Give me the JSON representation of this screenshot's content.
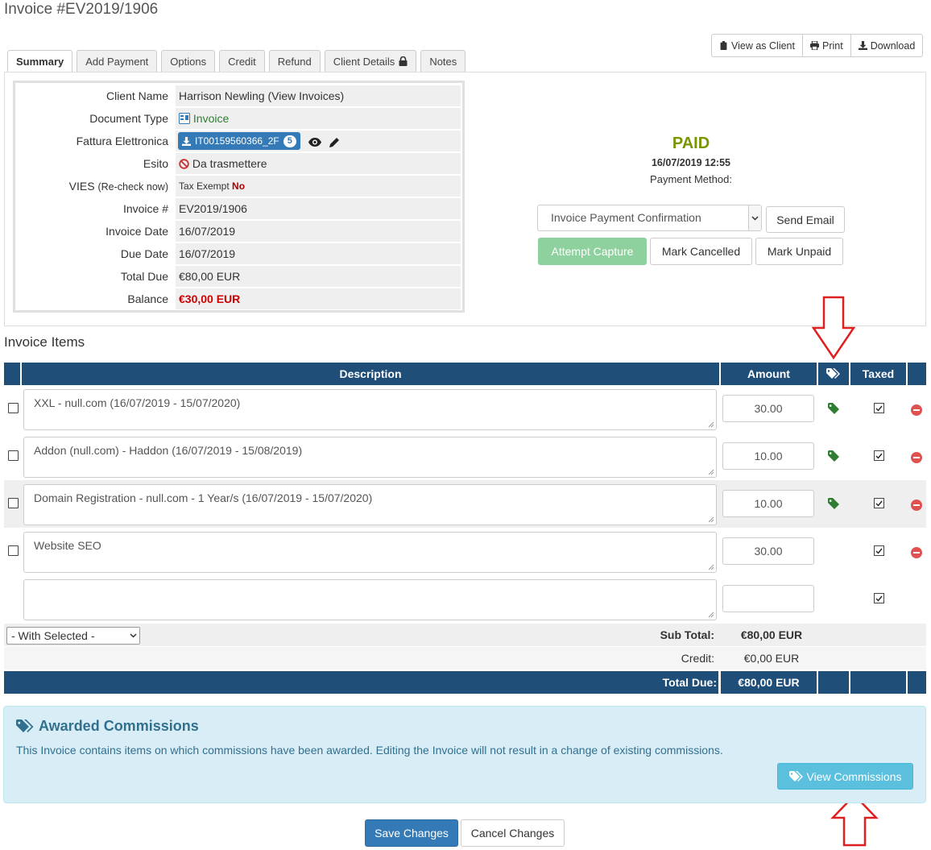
{
  "page_title": "Invoice #EV2019/1906",
  "toolbar": {
    "view_as_client": "View as Client",
    "print": "Print",
    "download": "Download"
  },
  "tabs": [
    {
      "label": "Summary",
      "active": true
    },
    {
      "label": "Add Payment"
    },
    {
      "label": "Options"
    },
    {
      "label": "Credit"
    },
    {
      "label": "Refund"
    },
    {
      "label": "Client Details",
      "icon": "lock-icon"
    },
    {
      "label": "Notes"
    }
  ],
  "summary": {
    "client_name_label": "Client Name",
    "client_name": "Harrison Newling",
    "view_invoices": "(View Invoices)",
    "document_type_label": "Document Type",
    "document_type": "Invoice",
    "fattura_label": "Fattura Elettronica",
    "fattura_file": "IT00159560366_2F",
    "fattura_count": "5",
    "esito_label": "Esito",
    "esito_value": "Da trasmettere",
    "vies_label": "VIES",
    "vies_recheck": "(Re-check now)",
    "tax_exempt_label": "Tax Exempt",
    "tax_exempt_value": "No",
    "invoice_num_label": "Invoice #",
    "invoice_num": "EV2019/1906",
    "invoice_date_label": "Invoice Date",
    "invoice_date": "16/07/2019",
    "due_date_label": "Due Date",
    "due_date": "16/07/2019",
    "total_due_label": "Total Due",
    "total_due": "€80,00 EUR",
    "balance_label": "Balance",
    "balance": "€30,00 EUR"
  },
  "status": {
    "label": "PAID",
    "datetime": "16/07/2019 12:55",
    "payment_method": "Payment Method:",
    "email_template": "Invoice Payment Confirmation",
    "send_email": "Send Email",
    "attempt_capture": "Attempt Capture",
    "mark_cancelled": "Mark Cancelled",
    "mark_unpaid": "Mark Unpaid",
    "paid_color": "#779500"
  },
  "items": {
    "title": "Invoice Items",
    "columns": {
      "description": "Description",
      "amount": "Amount",
      "taxed": "Taxed"
    },
    "rows": [
      {
        "description": "XXL - null.com (16/07/2019 - 15/07/2020)",
        "amount": "30.00",
        "tagged": true,
        "taxed": true
      },
      {
        "description": "Addon (null.com) - Haddon (16/07/2019 - 15/08/2019)",
        "amount": "10.00",
        "tagged": true,
        "taxed": true
      },
      {
        "description": "Domain Registration - null.com - 1 Year/s (16/07/2019 - 15/07/2020)",
        "amount": "10.00",
        "tagged": true,
        "taxed": true
      },
      {
        "description": "Website SEO",
        "amount": "30.00",
        "tagged": false,
        "taxed": true
      }
    ],
    "new_row": {
      "description": "",
      "amount": "",
      "taxed": true
    },
    "with_selected": "- With Selected -",
    "sub_total_label": "Sub Total:",
    "sub_total": "€80,00 EUR",
    "credit_label": "Credit:",
    "credit": "€0,00 EUR",
    "total_due_label": "Total Due:",
    "total_due": "€80,00 EUR"
  },
  "commissions": {
    "title": "Awarded Commissions",
    "text": "This Invoice contains items on which commissions have been awarded. Editing the Invoice will not result in a change of existing commissions.",
    "button": "View Commissions"
  },
  "footer": {
    "save": "Save Changes",
    "cancel": "Cancel Changes"
  },
  "colors": {
    "header_blue": "#1f4e79",
    "primary": "#337ab7",
    "info": "#5bc0de",
    "annotation_arrow": "#e02020"
  }
}
